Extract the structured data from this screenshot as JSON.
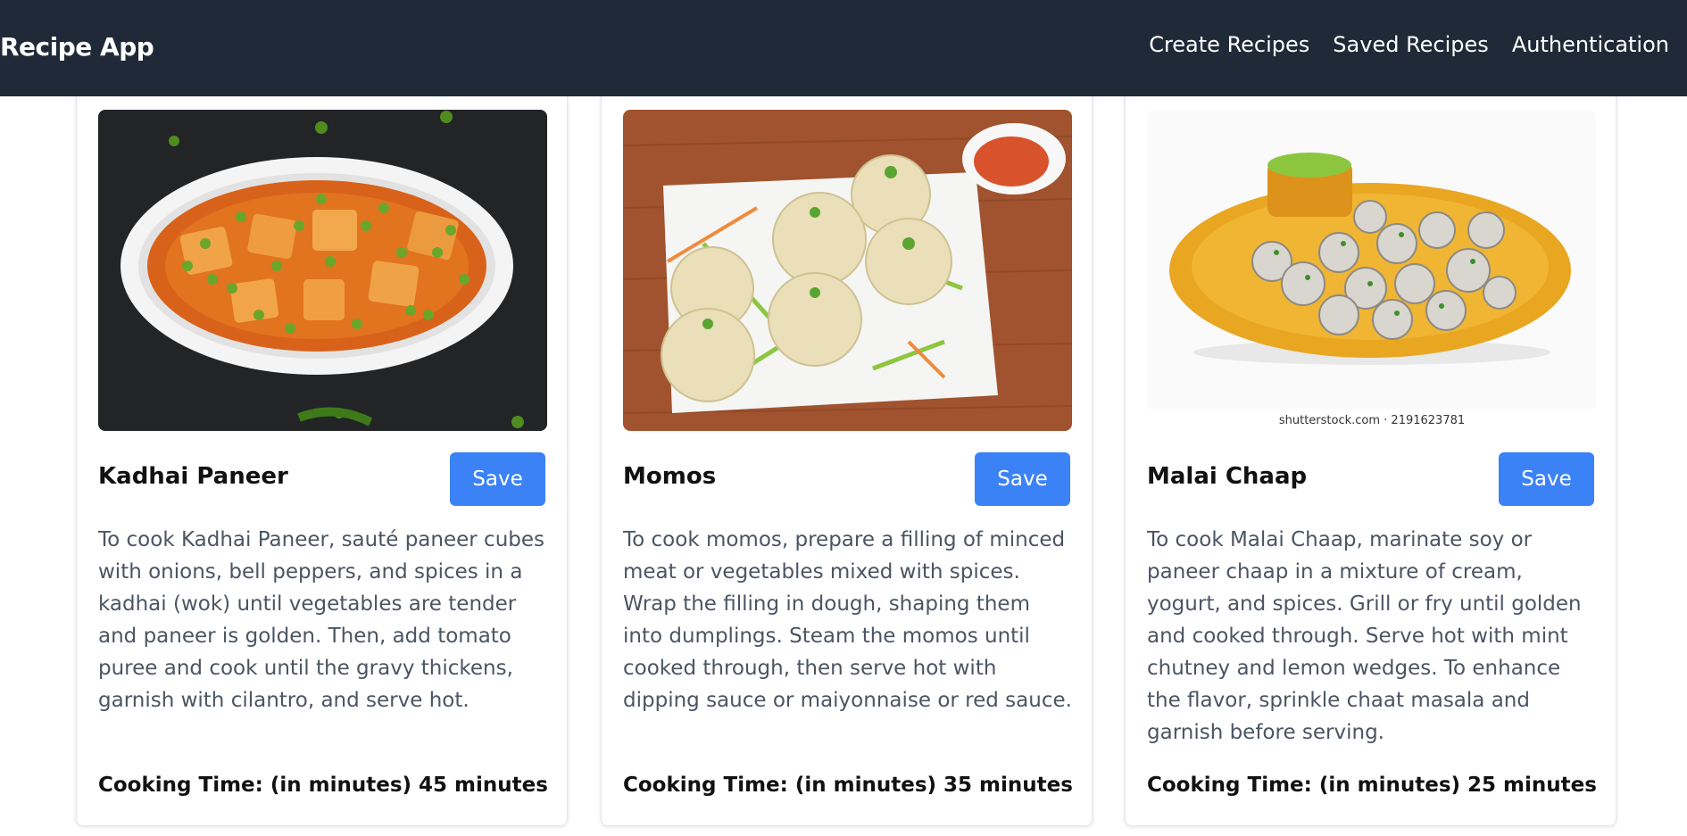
{
  "app": {
    "title": "Recipe App"
  },
  "nav": {
    "links": [
      "Create Recipes",
      "Saved Recipes",
      "Authentication"
    ]
  },
  "colors": {
    "navbar_bg": "#1f2937",
    "save_button": "#3b82f6",
    "description_text": "#4b5563"
  },
  "recipes": [
    {
      "name": "Kadhai Paneer",
      "save_label": "Save",
      "description": "To cook Kadhai Paneer, sauté paneer cubes with onions, bell peppers, and spices in a kadhai (wok) until vegetables are tender and paneer is golden. Then, add tomato puree and cook until the gravy thickens, garnish with cilantro, and serve hot.",
      "cooking_time": "Cooking Time: (in minutes) 45 minutes"
    },
    {
      "name": "Momos",
      "save_label": "Save",
      "description": "To cook momos, prepare a filling of minced meat or vegetables mixed with spices. Wrap the filling in dough, shaping them into dumplings. Steam the momos until cooked through, then serve hot with dipping sauce or maiyonnaise or red sauce.",
      "cooking_time": "Cooking Time: (in minutes) 35 minutes"
    },
    {
      "name": "Malai Chaap",
      "save_label": "Save",
      "description": "To cook Malai Chaap, marinate soy or paneer chaap in a mixture of cream, yogurt, and spices. Grill or fry until golden and cooked through. Serve hot with mint chutney and lemon wedges. To enhance the flavor, sprinkle chaat masala and garnish before serving.",
      "cooking_time": "Cooking Time: (in minutes) 25 minutes",
      "image_watermark": "shutterstock.com · 2191623781"
    }
  ]
}
